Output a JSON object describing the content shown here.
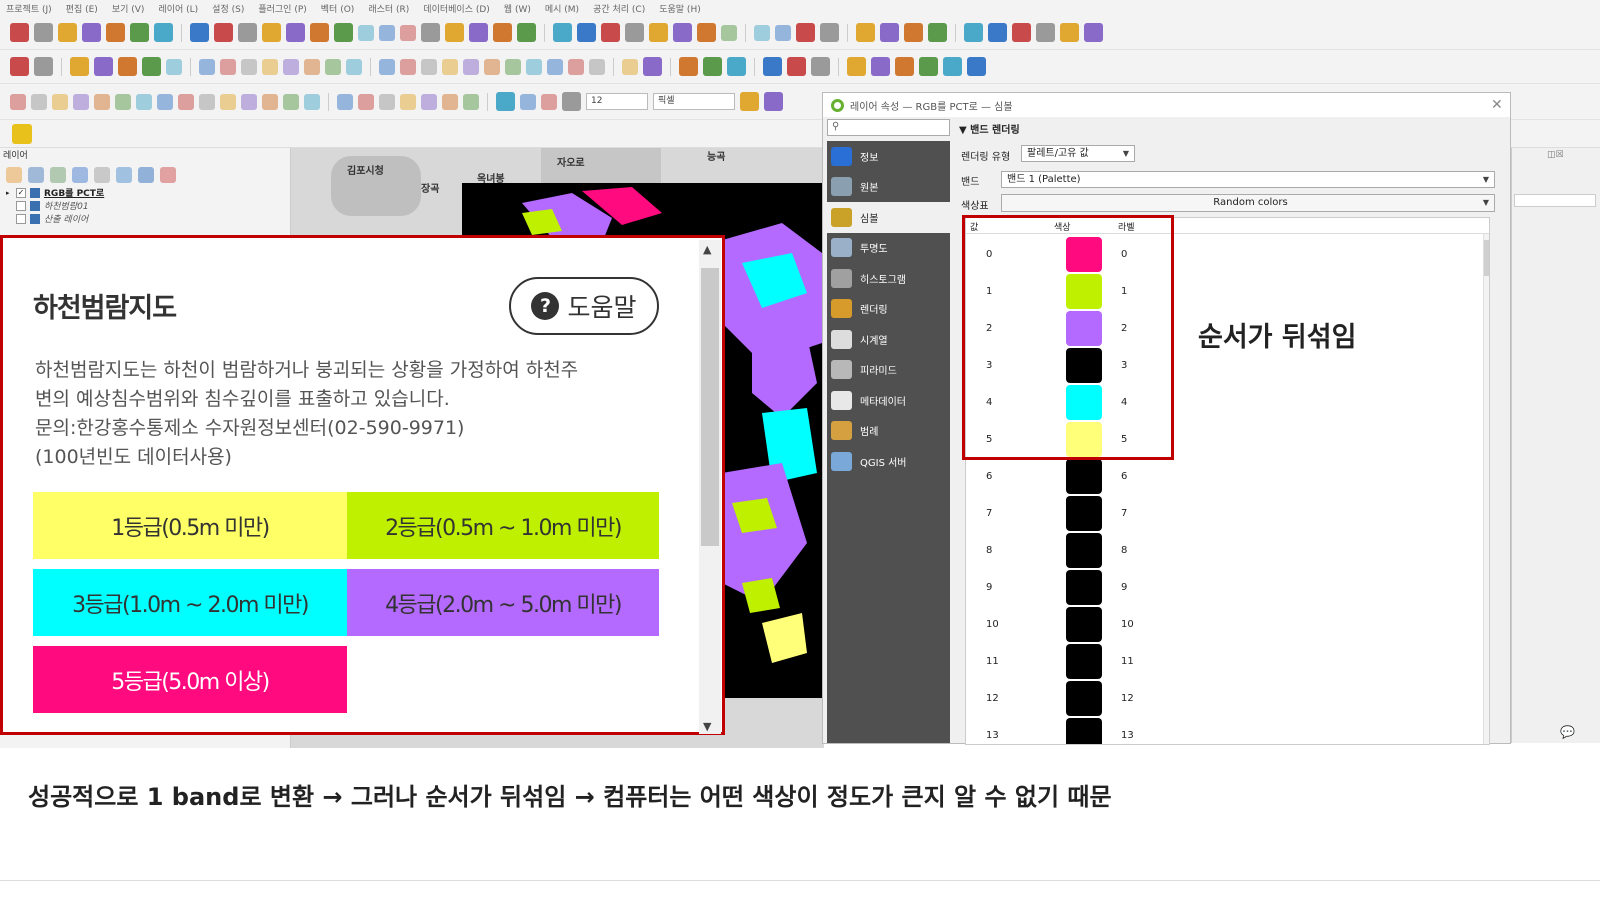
{
  "menubar": {
    "items": [
      "프로젝트 (J)",
      "편집 (E)",
      "보기 (V)",
      "레이어 (L)",
      "설정 (S)",
      "플러그인 (P)",
      "벡터 (O)",
      "래스터 (R)",
      "데이터베이스 (D)",
      "웹 (W)",
      "메시 (M)",
      "공간 처리 (C)",
      "도움말 (H)"
    ]
  },
  "toolbar": {
    "snap_tolerance": "12",
    "snap_unit": "픽셀"
  },
  "layers_panel": {
    "title": "레이어",
    "layers": [
      {
        "name": "RGB를 PCT로",
        "checked": true
      },
      {
        "name": "하천범람01",
        "checked": false
      },
      {
        "name": "산출 레이어",
        "checked": false
      }
    ]
  },
  "map": {
    "labels": [
      "김포시청",
      "장곡",
      "옥녀봉",
      "자오로",
      "능곡"
    ]
  },
  "popup": {
    "title": "하천범람지도",
    "help_icon": "?",
    "help_label": "도움말",
    "desc_lines": [
      "하천범람지도는 하천이 범람하거나 붕괴되는 상황을 가정하여 하천주",
      "변의 예상침수범위와 침수깊이를 표출하고 있습니다.",
      "문의:한강홍수통제소 수자원정보센터(02-590-9971)",
      "(100년빈도 데이터사용)"
    ],
    "grades": [
      {
        "label": "1등급(0.5m 미만)",
        "color": "#ffff66"
      },
      {
        "label": "2등급(0.5m ~ 1.0m 미만)",
        "color": "#bff000"
      },
      {
        "label": "3등급(1.0m ~ 2.0m 미만)",
        "color": "#00ffff"
      },
      {
        "label": "4등급(2.0m ~ 5.0m 미만)",
        "color": "#b469ff"
      },
      {
        "label": "5등급(5.0m 이상)",
        "color": "#ff0a7f"
      }
    ]
  },
  "dialog": {
    "title": "레이어 속성 — RGB를 PCT로 — 심볼",
    "nav": [
      {
        "label": "정보",
        "icon": "info-icon",
        "color": "#2a6fd6"
      },
      {
        "label": "원본",
        "icon": "source-icon",
        "color": "#8aa0b0"
      },
      {
        "label": "심볼",
        "icon": "symbology-icon",
        "color": "#c9a227"
      },
      {
        "label": "투명도",
        "icon": "transparency-icon",
        "color": "#9ab0c8"
      },
      {
        "label": "히스토그램",
        "icon": "histogram-icon",
        "color": "#a0a0a0"
      },
      {
        "label": "렌더링",
        "icon": "rendering-icon",
        "color": "#d69b2a"
      },
      {
        "label": "시계열",
        "icon": "clock-icon",
        "color": "#dddddd"
      },
      {
        "label": "피라미드",
        "icon": "pyramid-icon",
        "color": "#b8b8b8"
      },
      {
        "label": "메타데이터",
        "icon": "metadata-icon",
        "color": "#e8e8e8"
      },
      {
        "label": "범례",
        "icon": "legend-icon",
        "color": "#d4a040"
      },
      {
        "label": "QGIS 서버",
        "icon": "server-icon",
        "color": "#7aa8d8"
      }
    ],
    "section_title": "밴드 렌더링",
    "render_type_label": "렌더링 유형",
    "render_type_value": "팔레트/고유 값",
    "band_label": "밴드",
    "band_value": "밴드 1 (Palette)",
    "color_ramp_label": "색상표",
    "color_ramp_value": "Random colors",
    "table_headers": {
      "value": "값",
      "color": "색상",
      "label": "라벨"
    },
    "palette": [
      {
        "value": "0",
        "color": "#ff0a7f",
        "label": "0"
      },
      {
        "value": "1",
        "color": "#bff000",
        "label": "1"
      },
      {
        "value": "2",
        "color": "#b469ff",
        "label": "2"
      },
      {
        "value": "3",
        "color": "#000000",
        "label": "3"
      },
      {
        "value": "4",
        "color": "#00ffff",
        "label": "4"
      },
      {
        "value": "5",
        "color": "#ffff7a",
        "label": "5"
      },
      {
        "value": "6",
        "color": "#000000",
        "label": "6"
      },
      {
        "value": "7",
        "color": "#000000",
        "label": "7"
      },
      {
        "value": "8",
        "color": "#000000",
        "label": "8"
      },
      {
        "value": "9",
        "color": "#000000",
        "label": "9"
      },
      {
        "value": "10",
        "color": "#000000",
        "label": "10"
      },
      {
        "value": "11",
        "color": "#000000",
        "label": "11"
      },
      {
        "value": "12",
        "color": "#000000",
        "label": "12"
      },
      {
        "value": "13",
        "color": "#000000",
        "label": "13"
      }
    ]
  },
  "annotation": {
    "shuffled_note": "순서가 뒤섞임"
  },
  "caption": "성공적으로 1 band로 변환 → 그러나 순서가 뒤섞임 → 컴퓨터는 어떤 색상이 정도가 큰지 알 수 없기 때문"
}
